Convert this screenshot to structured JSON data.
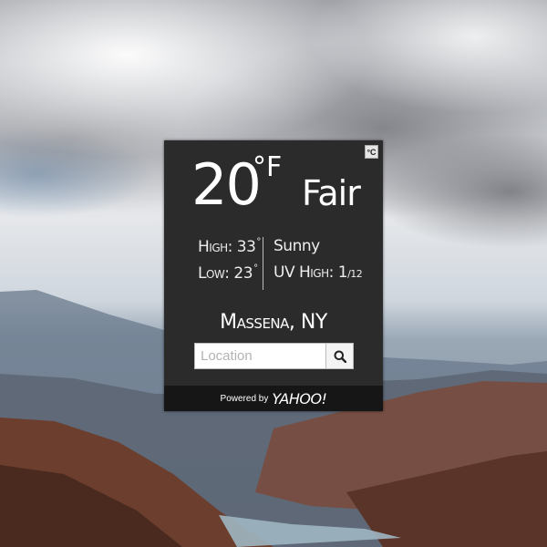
{
  "widget": {
    "unit_toggle": "°C",
    "temperature": "20",
    "temperature_unit": "°F",
    "condition": "Fair",
    "high_label": "High:",
    "high_value": "33",
    "low_label": "Low:",
    "low_value": "23",
    "degree_symbol": "°",
    "forecast": "Sunny",
    "uv_label": "UV High:",
    "uv_value": "1",
    "uv_scale": "/12",
    "location": "Massena, NY",
    "search": {
      "placeholder": "Location",
      "value": ""
    },
    "footer": {
      "powered_by": "Powered by",
      "brand": "YAHOO!"
    }
  },
  "colors": {
    "widget_bg": "#2b2b2b",
    "footer_bg": "#161616",
    "text": "#ffffff"
  },
  "icons": {
    "search": "magnifier-icon"
  }
}
